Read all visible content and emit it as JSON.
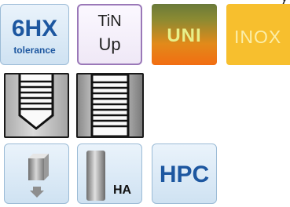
{
  "tiles": {
    "tolerance": {
      "main": "6HX",
      "sub": "tolerance"
    },
    "coating": {
      "line1": "TiN",
      "line2": "Up"
    },
    "uni": {
      "label": "UNI"
    },
    "inox": {
      "label": "INOX"
    },
    "blind_hole": {
      "icon": "blind-hole-thread-icon"
    },
    "through_hole": {
      "icon": "through-hole-thread-icon"
    },
    "down": {
      "icon": "cylinder-down-arrow-icon"
    },
    "ha": {
      "label": "HA",
      "icon": "shank-cylinder-icon"
    },
    "hpc": {
      "label": "HPC"
    }
  },
  "colors": {
    "blue_text": "#1d57a0",
    "uni_gradient_top": "#6a7a3a",
    "uni_gradient_bottom": "#f26d12",
    "inox_bg": "#f7bf2e",
    "coating_border": "#9a78b8"
  }
}
